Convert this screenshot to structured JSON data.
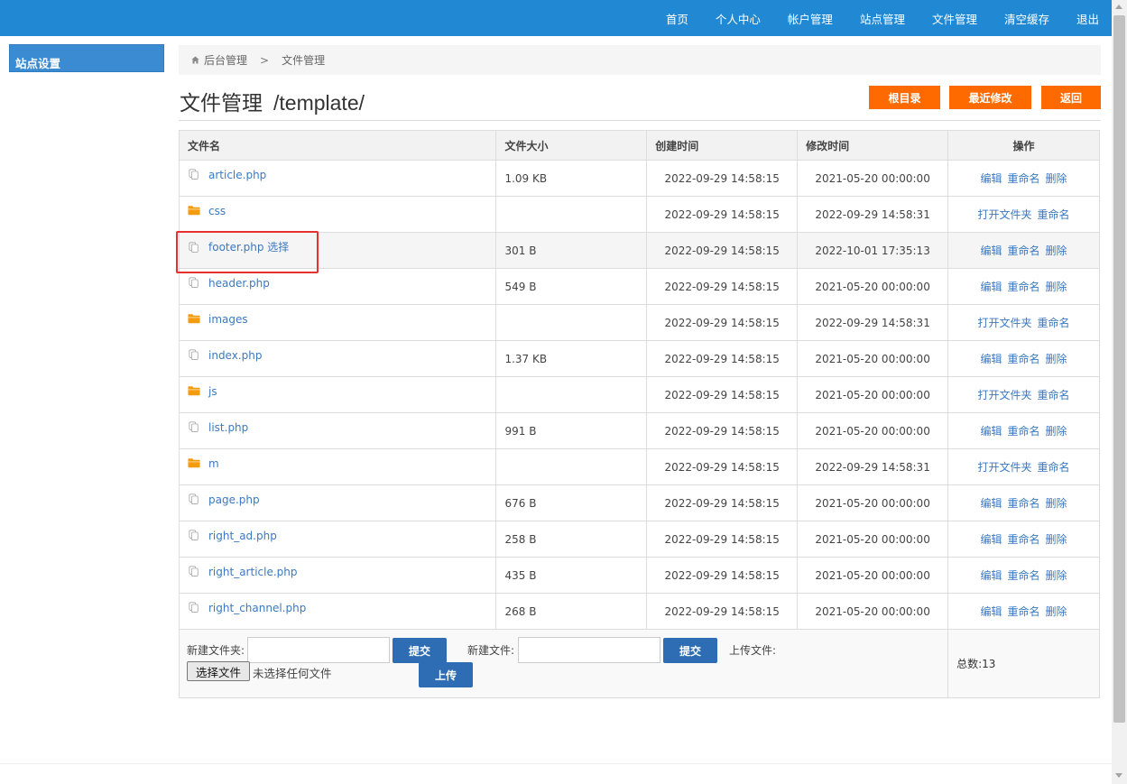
{
  "nav": {
    "items": [
      "首页",
      "个人中心",
      "帐户管理",
      "站点管理",
      "文件管理",
      "清空缓存",
      "退出"
    ]
  },
  "sidebar": {
    "title": "站点设置"
  },
  "breadcrumb": {
    "root": "后台管理",
    "separator": ">",
    "current": "文件管理"
  },
  "header": {
    "title": "文件管理",
    "path": "/template/",
    "buttons": {
      "root_dir": "根目录",
      "recent": "最近修改",
      "back": "返回"
    }
  },
  "table": {
    "columns": [
      "文件名",
      "文件大小",
      "创建时间",
      "修改时间",
      "操作"
    ],
    "rows": [
      {
        "type": "file",
        "name": "article.php",
        "size": "1.09 KB",
        "created": "2022-09-29 14:58:15",
        "modified": "2021-05-20 00:00:00",
        "ops": [
          "编辑",
          "重命名",
          "删除"
        ]
      },
      {
        "type": "folder",
        "name": "css",
        "size": "",
        "created": "2022-09-29 14:58:15",
        "modified": "2022-09-29 14:58:31",
        "ops": [
          "打开文件夹",
          "重命名"
        ]
      },
      {
        "type": "file",
        "name": "footer.php 选择",
        "size": "301 B",
        "created": "2022-09-29 14:58:15",
        "modified": "2022-10-01 17:35:13",
        "ops": [
          "编辑",
          "重命名",
          "删除"
        ]
      },
      {
        "type": "file",
        "name": "header.php",
        "size": "549 B",
        "created": "2022-09-29 14:58:15",
        "modified": "2021-05-20 00:00:00",
        "ops": [
          "编辑",
          "重命名",
          "删除"
        ]
      },
      {
        "type": "folder",
        "name": "images",
        "size": "",
        "created": "2022-09-29 14:58:15",
        "modified": "2022-09-29 14:58:31",
        "ops": [
          "打开文件夹",
          "重命名"
        ]
      },
      {
        "type": "file",
        "name": "index.php",
        "size": "1.37 KB",
        "created": "2022-09-29 14:58:15",
        "modified": "2021-05-20 00:00:00",
        "ops": [
          "编辑",
          "重命名",
          "删除"
        ]
      },
      {
        "type": "folder",
        "name": "js",
        "size": "",
        "created": "2022-09-29 14:58:15",
        "modified": "2021-05-20 00:00:00",
        "ops": [
          "打开文件夹",
          "重命名"
        ]
      },
      {
        "type": "file",
        "name": "list.php",
        "size": "991 B",
        "created": "2022-09-29 14:58:15",
        "modified": "2021-05-20 00:00:00",
        "ops": [
          "编辑",
          "重命名",
          "删除"
        ]
      },
      {
        "type": "folder",
        "name": "m",
        "size": "",
        "created": "2022-09-29 14:58:15",
        "modified": "2022-09-29 14:58:31",
        "ops": [
          "打开文件夹",
          "重命名"
        ]
      },
      {
        "type": "file",
        "name": "page.php",
        "size": "676 B",
        "created": "2022-09-29 14:58:15",
        "modified": "2021-05-20 00:00:00",
        "ops": [
          "编辑",
          "重命名",
          "删除"
        ]
      },
      {
        "type": "file",
        "name": "right_ad.php",
        "size": "258 B",
        "created": "2022-09-29 14:58:15",
        "modified": "2021-05-20 00:00:00",
        "ops": [
          "编辑",
          "重命名",
          "删除"
        ]
      },
      {
        "type": "file",
        "name": "right_article.php",
        "size": "435 B",
        "created": "2022-09-29 14:58:15",
        "modified": "2021-05-20 00:00:00",
        "ops": [
          "编辑",
          "重命名",
          "删除"
        ]
      },
      {
        "type": "file",
        "name": "right_channel.php",
        "size": "268 B",
        "created": "2022-09-29 14:58:15",
        "modified": "2021-05-20 00:00:00",
        "ops": [
          "编辑",
          "重命名",
          "删除"
        ]
      }
    ]
  },
  "form": {
    "new_folder_label": "新建文件夹:",
    "new_folder_value": "",
    "new_file_label": "新建文件:",
    "new_file_value": "",
    "submit": "提交",
    "upload_label": "上传文件:",
    "choose_file": "选择文件",
    "no_file": "未选择任何文件",
    "upload": "上传",
    "total": "总数:13"
  },
  "colors": {
    "nav_bg": "#2189d4",
    "accent_orange": "#ff6a00",
    "button_blue": "#2e6db4",
    "link": "#3b79c0",
    "highlight_box": "#e8302f"
  },
  "icons": {
    "file": "file-copy-icon",
    "folder": "folder-icon",
    "home": "home-icon"
  }
}
